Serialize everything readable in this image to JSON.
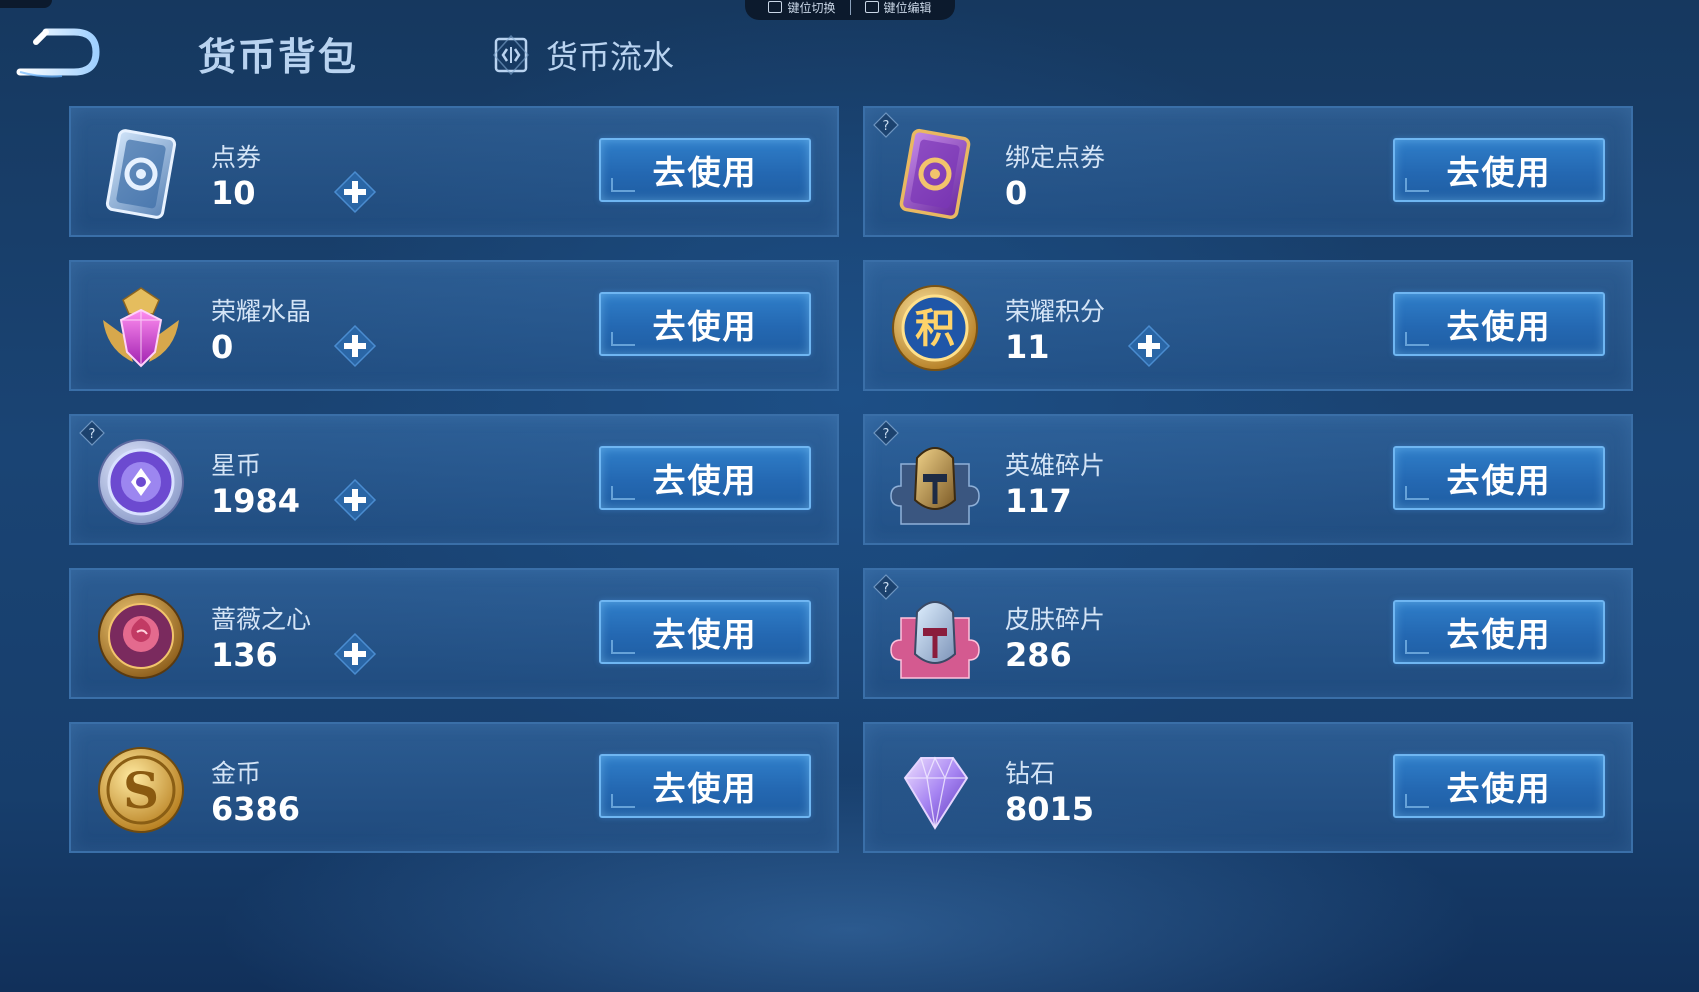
{
  "header": {
    "title": "货币背包",
    "flow_tab_label": "货币流水",
    "hint_left": "键位切换",
    "hint_right": "键位编辑"
  },
  "currencies": [
    {
      "name": "点券",
      "amount": "10",
      "icon": "coupon-icon",
      "has_plus": true,
      "has_help": false,
      "button": "去使用"
    },
    {
      "name": "绑定点券",
      "amount": "0",
      "icon": "bound-coupon-icon",
      "has_plus": false,
      "has_help": true,
      "button": "去使用"
    },
    {
      "name": "荣耀水晶",
      "amount": "0",
      "icon": "glory-crystal-icon",
      "has_plus": true,
      "has_help": false,
      "button": "去使用"
    },
    {
      "name": "荣耀积分",
      "amount": "11",
      "icon": "glory-points-icon",
      "has_plus": true,
      "has_help": false,
      "button": "去使用"
    },
    {
      "name": "星币",
      "amount": "1984",
      "icon": "star-coin-icon",
      "has_plus": true,
      "has_help": true,
      "button": "去使用"
    },
    {
      "name": "英雄碎片",
      "amount": "117",
      "icon": "hero-fragment-icon",
      "has_plus": false,
      "has_help": true,
      "button": "去使用"
    },
    {
      "name": "蔷薇之心",
      "amount": "136",
      "icon": "rose-heart-icon",
      "has_plus": true,
      "has_help": false,
      "button": "去使用"
    },
    {
      "name": "皮肤碎片",
      "amount": "286",
      "icon": "skin-fragment-icon",
      "has_plus": false,
      "has_help": true,
      "button": "去使用"
    },
    {
      "name": "金币",
      "amount": "6386",
      "icon": "gold-coin-icon",
      "has_plus": false,
      "has_help": false,
      "button": "去使用"
    },
    {
      "name": "钻石",
      "amount": "8015",
      "icon": "diamond-icon",
      "has_plus": false,
      "has_help": false,
      "button": "去使用"
    }
  ],
  "colors": {
    "accent": "#2f7ec9",
    "card_border": "#3a6fa8",
    "title_text": "#b9d3f0"
  }
}
